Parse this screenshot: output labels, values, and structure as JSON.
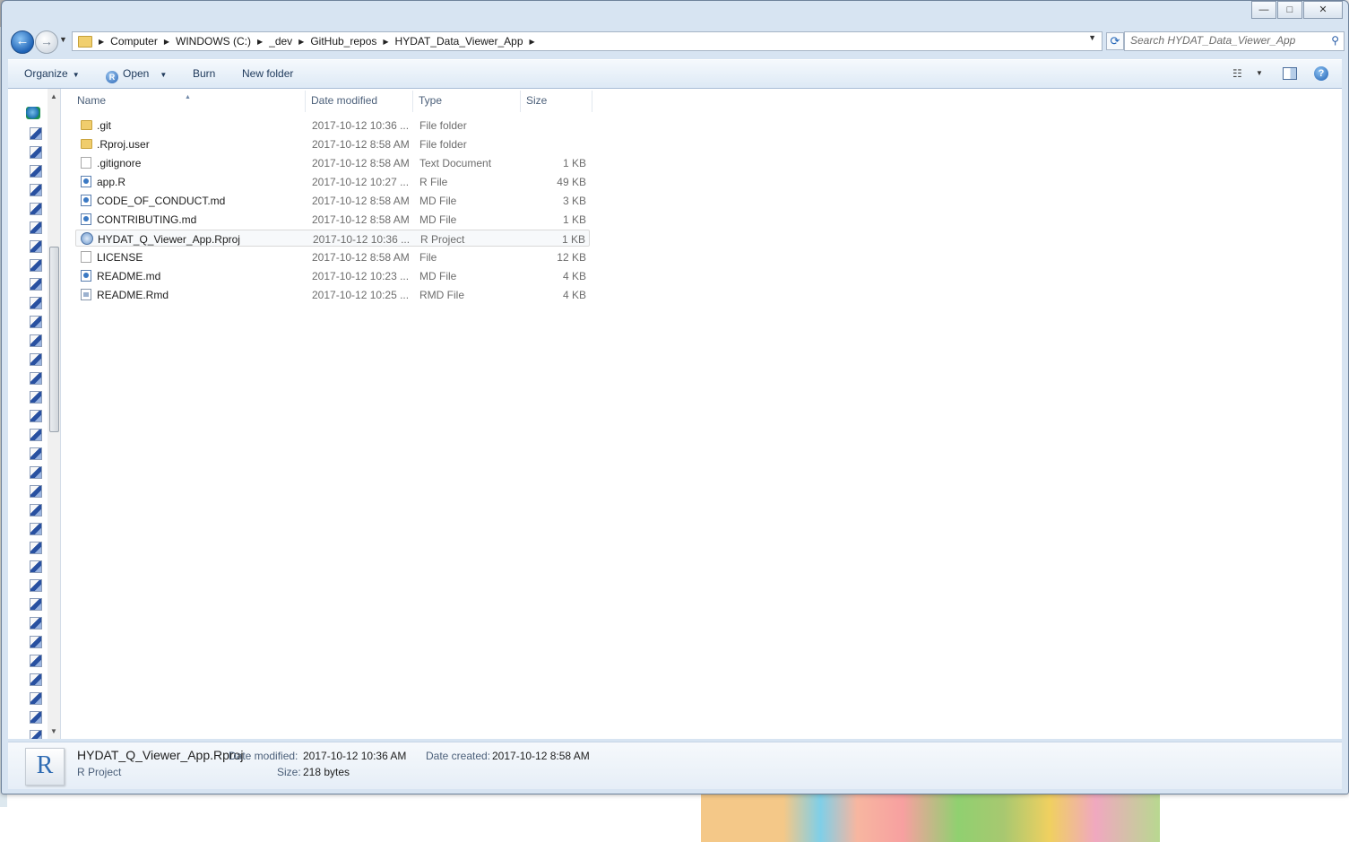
{
  "window": {
    "minimize_label": "—",
    "maximize_label": "□",
    "close_label": "✕"
  },
  "nav": {
    "back_glyph": "←",
    "forward_glyph": "→",
    "breadcrumbs": [
      "Computer",
      "WINDOWS (C:)",
      "_dev",
      "GitHub_repos",
      "HYDAT_Data_Viewer_App"
    ],
    "search_placeholder": "Search HYDAT_Data_Viewer_App"
  },
  "toolbar": {
    "organize": "Organize",
    "open": "Open",
    "burn": "Burn",
    "new_folder": "New folder",
    "help": "?"
  },
  "columns": {
    "name": "Name",
    "date": "Date modified",
    "type": "Type",
    "size": "Size"
  },
  "files": [
    {
      "name": ".git",
      "date": "2017-10-12 10:36 ...",
      "type": "File folder",
      "size": "",
      "icon": "folder-icon",
      "kind": "folder"
    },
    {
      "name": ".Rproj.user",
      "date": "2017-10-12 8:58 AM",
      "type": "File folder",
      "size": "",
      "icon": "folder-icon",
      "kind": "folder"
    },
    {
      "name": ".gitignore",
      "date": "2017-10-12 8:58 AM",
      "type": "Text Document",
      "size": "1 KB",
      "icon": "text-file-icon",
      "kind": "doc"
    },
    {
      "name": "app.R",
      "date": "2017-10-12 10:27 ...",
      "type": "R File",
      "size": "49 KB",
      "icon": "r-file-icon",
      "kind": "r"
    },
    {
      "name": "CODE_OF_CONDUCT.md",
      "date": "2017-10-12 8:58 AM",
      "type": "MD File",
      "size": "3 KB",
      "icon": "md-file-icon",
      "kind": "r"
    },
    {
      "name": "CONTRIBUTING.md",
      "date": "2017-10-12 8:58 AM",
      "type": "MD File",
      "size": "1 KB",
      "icon": "md-file-icon",
      "kind": "r"
    },
    {
      "name": "HYDAT_Q_Viewer_App.Rproj",
      "date": "2017-10-12 10:36 ...",
      "type": "R Project",
      "size": "1 KB",
      "icon": "rproj-file-icon",
      "kind": "proj",
      "selected": true
    },
    {
      "name": "LICENSE",
      "date": "2017-10-12 8:58 AM",
      "type": "File",
      "size": "12 KB",
      "icon": "generic-file-icon",
      "kind": "doc"
    },
    {
      "name": "README.md",
      "date": "2017-10-12 10:23 ...",
      "type": "MD File",
      "size": "4 KB",
      "icon": "md-file-icon",
      "kind": "r"
    },
    {
      "name": "README.Rmd",
      "date": "2017-10-12 10:25 ...",
      "type": "RMD File",
      "size": "4 KB",
      "icon": "rmd-file-icon",
      "kind": "rmd"
    }
  ],
  "details": {
    "thumb_letter": "R",
    "name": "HYDAT_Q_Viewer_App.Rproj",
    "type": "R Project",
    "date_modified_label": "Date modified:",
    "date_modified": "2017-10-12 10:36 AM",
    "date_created_label": "Date created:",
    "date_created": "2017-10-12 8:58 AM",
    "size_label": "Size:",
    "size": "218 bytes"
  }
}
